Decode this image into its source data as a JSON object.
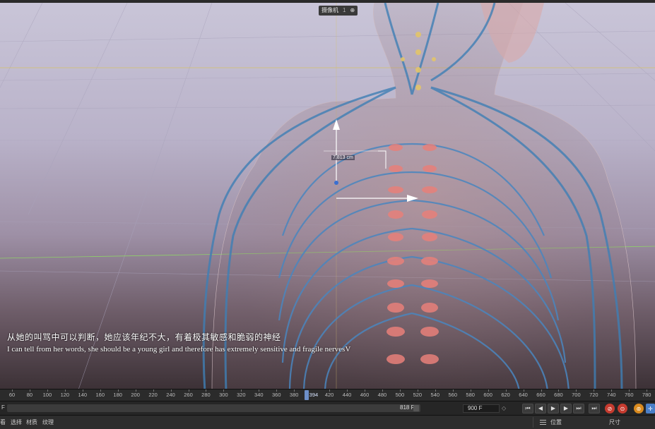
{
  "viewport": {
    "camera_label": "摄像机",
    "camera_sub": "1",
    "camera_extra": "⊕",
    "measure_text": "7.813 cm",
    "subtitle_cn": "从她的叫骂中可以判断，她应该年纪不大，有着极其敏感和脆弱的神经",
    "subtitle_en": "I can tell from her words, she should be a young girl and therefore has extremely sensitive and fragile nervesV"
  },
  "timeline": {
    "ticks": [
      "60",
      "80",
      "100",
      "120",
      "140",
      "160",
      "180",
      "200",
      "220",
      "240",
      "260",
      "280",
      "300",
      "320",
      "340",
      "360",
      "380",
      "420",
      "440",
      "460",
      "480",
      "500",
      "520",
      "540",
      "560",
      "580",
      "600",
      "620",
      "640",
      "660",
      "680",
      "700",
      "720",
      "740",
      "760",
      "780"
    ],
    "current_frame": "394",
    "start_label": "F",
    "range_end_label": "818 F",
    "end_frame": "900 F",
    "stepper": "◇"
  },
  "transport": {
    "first_icon": "skip-to-start-icon",
    "prev_key_icon": "previous-keyframe-icon",
    "play_icon": "play-icon",
    "next_key_icon": "next-keyframe-icon",
    "last_icon": "skip-to-end-icon",
    "end_icon": "go-to-end-icon"
  },
  "menu": {
    "items": [
      "看",
      "选择",
      "材质",
      "纹理"
    ],
    "right_items": [
      "位置",
      "尺寸"
    ]
  },
  "colors": {
    "nerve": "#3f7fb5",
    "vertebra_glow": "#e8807a",
    "axis_y": "#ffffff",
    "axis_x": "#ffffff",
    "playhead": "#6d8fc8"
  }
}
